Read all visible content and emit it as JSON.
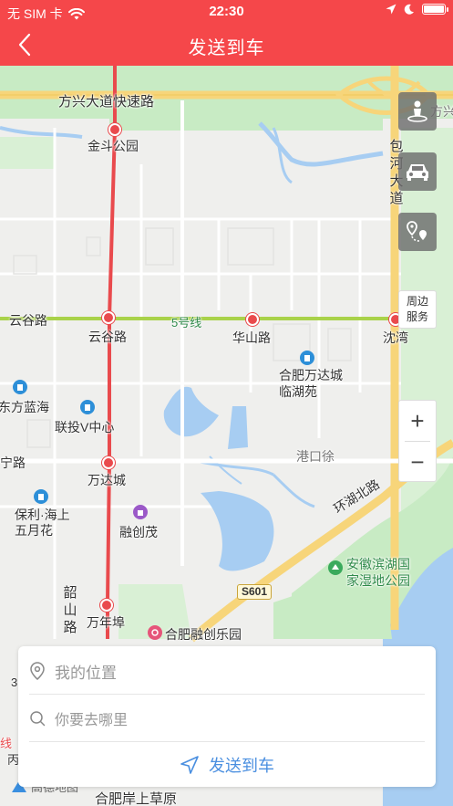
{
  "status_bar": {
    "carrier": "无 SIM 卡",
    "time": "22:30",
    "battery_level": 1.0
  },
  "nav": {
    "title": "发送到车",
    "back_icon": "chevron-left-icon"
  },
  "map": {
    "roads": {
      "fangxing": "方兴大道快速路",
      "fangxing_edge": "方兴",
      "baohe": "包河大道",
      "yungu_road": "云谷路",
      "line5": "5号线",
      "huanhu": "环湖北路",
      "shaoshan": "韶山路",
      "ningroad": "宁路",
      "highway": "S601",
      "edge_line": "线",
      "edge_bing": "丙",
      "edge_3": "3"
    },
    "places": {
      "jindou": "金斗公园",
      "yungu_station": "云谷路",
      "huashan": "华山路",
      "shenwan": "沈湾",
      "wanda_linhu": "合肥万达城临湖苑",
      "dongfang": "东方蓝海",
      "liantou": "联投V中心",
      "gangkouxu": "港口徐",
      "wandacheng": "万达城",
      "baoli": "保利·海上五月花",
      "rongchuangmao": "融创茂",
      "anhui_wetland": "安徽滨湖国家湿地公园",
      "wannianbu": "万年埠",
      "rongchuang_park": "合肥融创乐园",
      "anshang": "合肥岸上草原"
    },
    "controls": {
      "person_icon": "person-location-icon",
      "car_icon": "car-icon",
      "route_icon": "route-pin-icon",
      "nearby": "周边服务",
      "zoom_in": "+",
      "zoom_out": "−"
    },
    "logo": "高德地图",
    "colors": {
      "header": "#f5474a",
      "water": "#a7cdf2",
      "green": "#c8ebc4",
      "metro": "#e94a4d",
      "line5": "#a9d24a",
      "highway": "#f7d57a"
    }
  },
  "panel": {
    "my_location_placeholder": "我的位置",
    "destination_placeholder": "你要去哪里",
    "send_label": "发送到车"
  }
}
